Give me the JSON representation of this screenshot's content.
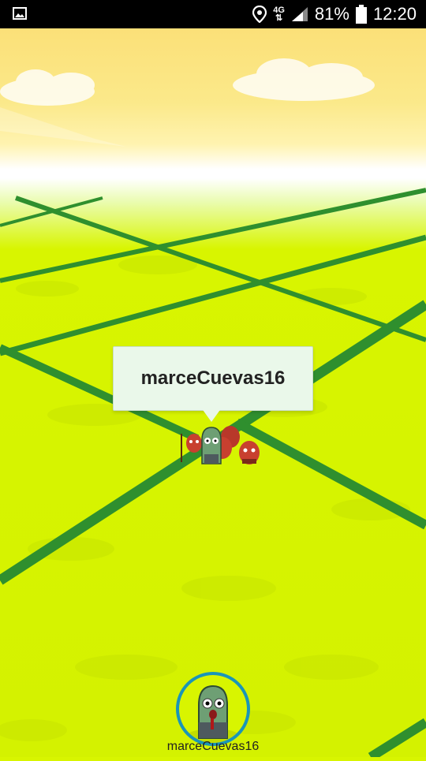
{
  "status_bar": {
    "network": "4G",
    "battery": "81%",
    "time": "12:20",
    "icons": [
      "image-icon",
      "location-icon",
      "signal-icon",
      "battery-icon"
    ]
  },
  "map": {
    "selected_player": {
      "name": "marceCuevas16"
    }
  },
  "player_bar": {
    "name": "marceCuevas16"
  },
  "colors": {
    "grass": "#d8f500",
    "road": "#2f8f2e",
    "avatar_ring": "#1a95b8"
  }
}
